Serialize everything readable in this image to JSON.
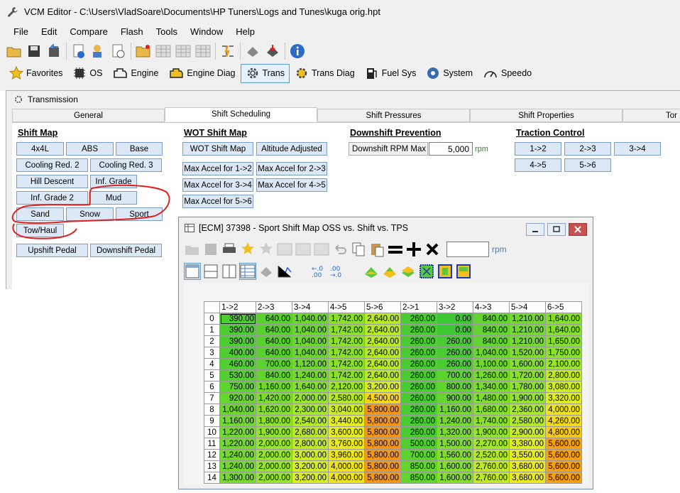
{
  "window": {
    "title": "VCM Editor - C:\\Users\\VladSoare\\Documents\\HP Tuners\\Logs and Tunes\\kuga orig.hpt"
  },
  "menu": [
    "File",
    "Edit",
    "Compare",
    "Flash",
    "Tools",
    "Window",
    "Help"
  ],
  "nav": [
    {
      "label": "Favorites",
      "icon": "star-icon"
    },
    {
      "label": "OS",
      "icon": "chip-icon"
    },
    {
      "label": "Engine",
      "icon": "engine-icon"
    },
    {
      "label": "Engine Diag",
      "icon": "engine-diag-icon"
    },
    {
      "label": "Trans",
      "icon": "gear-icon"
    },
    {
      "label": "Trans Diag",
      "icon": "trans-diag-icon"
    },
    {
      "label": "Fuel Sys",
      "icon": "fuel-pump-icon"
    },
    {
      "label": "System",
      "icon": "system-icon"
    },
    {
      "label": "Speedo",
      "icon": "speedometer-icon"
    }
  ],
  "panel": {
    "title": "Transmission",
    "tabs": [
      "General",
      "Shift Scheduling",
      "Shift Pressures",
      "Shift Properties",
      "Tor"
    ],
    "shift_map": {
      "title": "Shift Map",
      "buttons": [
        "4x4L",
        "ABS",
        "Base",
        "Cooling Red. 2",
        "Cooling Red. 3",
        "Hill Descent",
        "Inf. Grade",
        "Inf. Grade 2",
        "Mud",
        "Sand",
        "Snow",
        "Sport",
        "Tow/Haul",
        "Upshift Pedal",
        "Downshift Pedal"
      ]
    },
    "wot": {
      "title": "WOT Shift Map",
      "buttons": [
        "WOT Shift Map",
        "Altitude Adjusted",
        "Max Accel for 1->2",
        "Max Accel for 2->3",
        "Max Accel for 3->4",
        "Max Accel for 4->5",
        "Max Accel for 5->6"
      ]
    },
    "downshift": {
      "title": "Downshift Prevention",
      "label": "Downshift RPM Max",
      "value": "5,000",
      "unit": "rpm"
    },
    "traction": {
      "title": "Traction Control",
      "buttons": [
        "1->2",
        "2->3",
        "3->4",
        "4->5",
        "5->6"
      ]
    }
  },
  "table_window": {
    "title": "[ECM] 37398 - Sport Shift Map OSS vs. Shift vs. TPS",
    "rpm_label": "rpm",
    "columns": [
      "1->2",
      "2->3",
      "3->4",
      "4->5",
      "5->6",
      "2->1",
      "3->2",
      "4->3",
      "5->4",
      "6->5"
    ],
    "rows": [
      [
        "0",
        "390.00",
        "640.00",
        "1,040.00",
        "1,742.00",
        "2,640.00",
        "260.00",
        "0.00",
        "840.00",
        "1,210.00",
        "1,640.00"
      ],
      [
        "1",
        "390.00",
        "640.00",
        "1,040.00",
        "1,742.00",
        "2,640.00",
        "260.00",
        "0.00",
        "840.00",
        "1,210.00",
        "1,640.00"
      ],
      [
        "2",
        "390.00",
        "640.00",
        "1,040.00",
        "1,742.00",
        "2,640.00",
        "260.00",
        "260.00",
        "840.00",
        "1,210.00",
        "1,650.00"
      ],
      [
        "3",
        "400.00",
        "640.00",
        "1,040.00",
        "1,742.00",
        "2,640.00",
        "260.00",
        "260.00",
        "1,040.00",
        "1,520.00",
        "1,750.00"
      ],
      [
        "4",
        "460.00",
        "700.00",
        "1,120.00",
        "1,742.00",
        "2,640.00",
        "260.00",
        "260.00",
        "1,100.00",
        "1,600.00",
        "2,100.00"
      ],
      [
        "5",
        "530.00",
        "840.00",
        "1,240.00",
        "1,742.00",
        "2,640.00",
        "260.00",
        "700.00",
        "1,260.00",
        "1,720.00",
        "2,800.00"
      ],
      [
        "6",
        "750.00",
        "1,160.00",
        "1,640.00",
        "2,120.00",
        "3,200.00",
        "260.00",
        "800.00",
        "1,340.00",
        "1,780.00",
        "3,080.00"
      ],
      [
        "7",
        "920.00",
        "1,420.00",
        "2,000.00",
        "2,580.00",
        "4,500.00",
        "260.00",
        "900.00",
        "1,480.00",
        "1,900.00",
        "3,320.00"
      ],
      [
        "8",
        "1,040.00",
        "1,620.00",
        "2,300.00",
        "3,040.00",
        "5,800.00",
        "260.00",
        "1,160.00",
        "1,680.00",
        "2,360.00",
        "4,000.00"
      ],
      [
        "9",
        "1,160.00",
        "1,800.00",
        "2,540.00",
        "3,440.00",
        "5,800.00",
        "260.00",
        "1,240.00",
        "1,740.00",
        "2,580.00",
        "4,260.00"
      ],
      [
        "10",
        "1,220.00",
        "1,900.00",
        "2,680.00",
        "3,600.00",
        "5,800.00",
        "260.00",
        "1,320.00",
        "1,900.00",
        "2,900.00",
        "4,800.00"
      ],
      [
        "11",
        "1,220.00",
        "2,000.00",
        "2,800.00",
        "3,760.00",
        "5,800.00",
        "500.00",
        "1,500.00",
        "2,270.00",
        "3,380.00",
        "5,600.00"
      ],
      [
        "12",
        "1,240.00",
        "2,000.00",
        "3,000.00",
        "3,960.00",
        "5,800.00",
        "700.00",
        "1,560.00",
        "2,520.00",
        "3,550.00",
        "5,600.00"
      ],
      [
        "13",
        "1,240.00",
        "2,000.00",
        "3,200.00",
        "4,000.00",
        "5,800.00",
        "850.00",
        "1,600.00",
        "2,760.00",
        "3,680.00",
        "5,600.00"
      ],
      [
        "14",
        "1,300.00",
        "2,000.00",
        "3,200.00",
        "4,000.00",
        "5,800.00",
        "850.00",
        "1,600.00",
        "2,760.00",
        "3,680.00",
        "5,600.00"
      ]
    ]
  },
  "colors": {
    "annotation_red": "#e02020",
    "accent_blue": "#5a9bd5"
  }
}
